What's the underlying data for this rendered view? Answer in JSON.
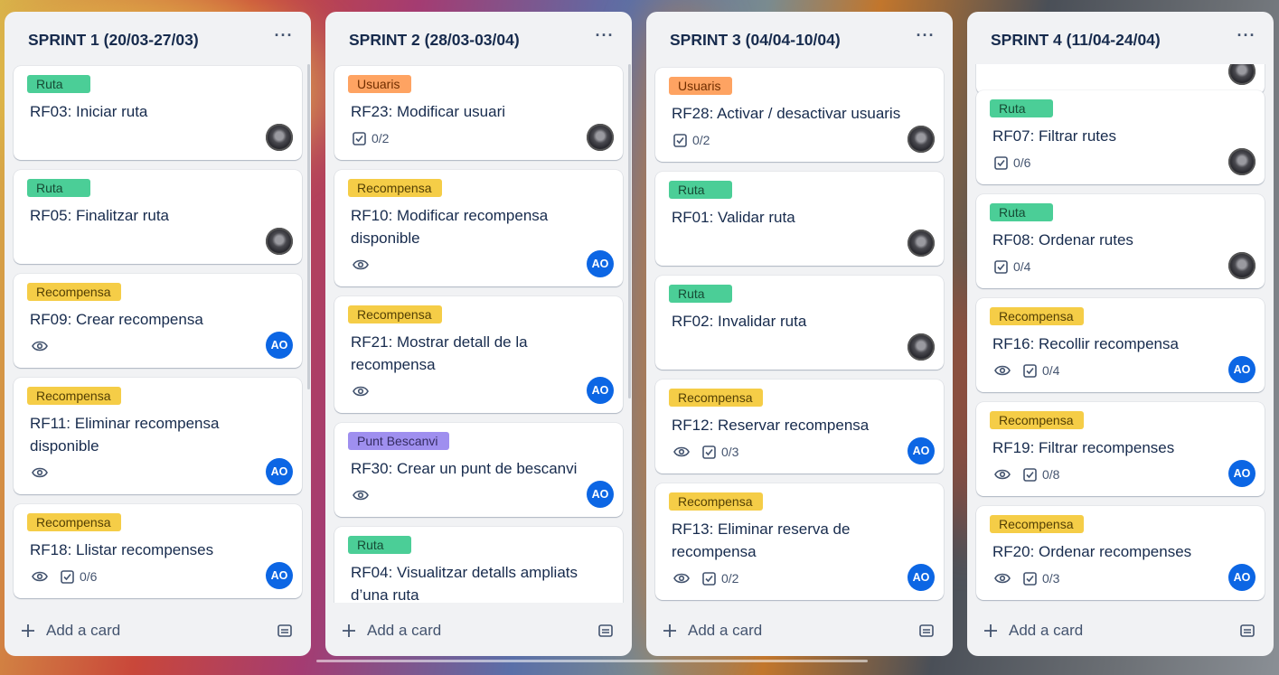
{
  "board": {
    "lists": [
      {
        "title": "SPRINT 1 (20/03-27/03)",
        "add_card": "Add a card",
        "cards": [
          {
            "label": "Ruta",
            "title": "RF03: Iniciar ruta",
            "checklist": "",
            "avatar": "photo"
          },
          {
            "label": "Ruta",
            "title": "RF05: Finalitzar ruta",
            "checklist": "",
            "avatar": "photo"
          },
          {
            "label": "Recompensa",
            "title": "RF09: Crear recompensa",
            "checklist": "",
            "avatar": "AO"
          },
          {
            "label": "Recompensa",
            "title": "RF11: Eliminar recompensa disponible",
            "checklist": "",
            "avatar": "AO"
          },
          {
            "label": "Recompensa",
            "title": "RF18: Llistar recompenses",
            "checklist": "0/6",
            "avatar": "AO"
          }
        ]
      },
      {
        "title": "SPRINT 2 (28/03-03/04)",
        "add_card": "Add a card",
        "cards": [
          {
            "label": "Usuaris",
            "title": "RF23: Modificar usuari",
            "checklist": "0/2",
            "avatar": "photo"
          },
          {
            "label": "Recompensa",
            "title": "RF10: Modificar recompensa disponible",
            "checklist": "",
            "avatar": "AO"
          },
          {
            "label": "Recompensa",
            "title": "RF21: Mostrar detall de la recompensa",
            "checklist": "",
            "avatar": "AO"
          },
          {
            "label": "Punt Bescanvi",
            "title": "RF30: Crear un punt de bescanvi",
            "checklist": "",
            "avatar": "AO"
          },
          {
            "label": "Ruta",
            "title": "RF04: Visualitzar detalls ampliats d’una ruta",
            "checklist": "",
            "avatar": ""
          }
        ]
      },
      {
        "title": "SPRINT 3 (04/04-10/04)",
        "add_card": "Add a card",
        "cards": [
          {
            "label": "Usuaris",
            "title": "RF28: Activar / desactivar usuaris",
            "checklist": "0/2",
            "avatar": "photo"
          },
          {
            "label": "Ruta",
            "title": "RF01: Validar ruta",
            "checklist": "",
            "avatar": "photo"
          },
          {
            "label": "Ruta",
            "title": "RF02: Invalidar ruta",
            "checklist": "",
            "avatar": "photo"
          },
          {
            "label": "Recompensa",
            "title": "RF12: Reservar recompensa",
            "checklist": "0/3",
            "avatar": "AO"
          },
          {
            "label": "Recompensa",
            "title": "RF13: Eliminar reserva de recompensa",
            "checklist": "0/2",
            "avatar": "AO"
          }
        ]
      },
      {
        "title": "SPRINT 4 (11/04-24/04)",
        "add_card": "Add a card",
        "cards": [
          {
            "label": "Ruta",
            "title": "RF07: Filtrar rutes",
            "checklist": "0/6",
            "avatar": "photo"
          },
          {
            "label": "Ruta",
            "title": "RF08: Ordenar rutes",
            "checklist": "0/4",
            "avatar": "photo"
          },
          {
            "label": "Recompensa",
            "title": "RF16: Recollir recompensa",
            "checklist": "0/4",
            "avatar": "AO"
          },
          {
            "label": "Recompensa",
            "title": "RF19: Filtrar recompenses",
            "checklist": "0/8",
            "avatar": "AO"
          },
          {
            "label": "Recompensa",
            "title": "RF20: Ordenar recompenses",
            "checklist": "0/3",
            "avatar": "AO"
          }
        ]
      }
    ]
  },
  "colors": {
    "label_green": "#4bce97",
    "label_yellow": "#f5cd47",
    "label_orange": "#fea362",
    "label_purple": "#9f8fef",
    "avatar_blue": "#0c66e4",
    "list_bg": "#f1f2f4"
  },
  "icons": {
    "list_menu": "more-horizontal-icon",
    "watch": "eye-icon",
    "checklist": "checkbox-icon",
    "add": "plus-icon",
    "template": "card-template-icon"
  }
}
